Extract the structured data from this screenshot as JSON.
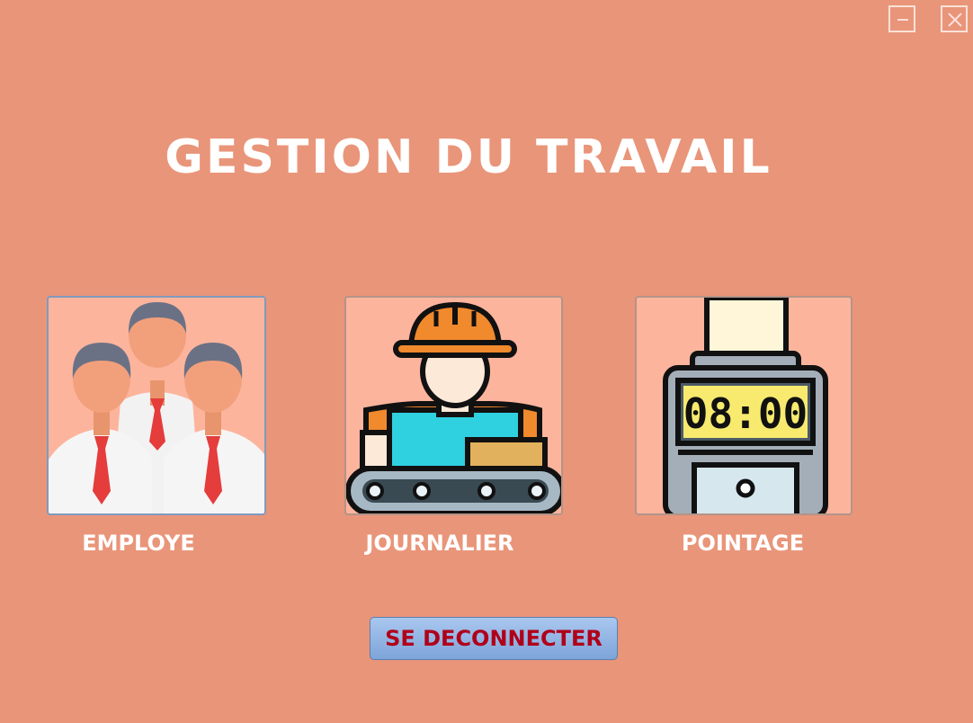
{
  "window": {
    "minimize_icon": "minimize-icon",
    "close_icon": "close-icon",
    "background_color": "#E9957A"
  },
  "header": {
    "title": "GESTION DU TRAVAIL"
  },
  "menu": {
    "items": [
      {
        "label": "EMPLOYE",
        "icon": "employees-group-icon"
      },
      {
        "label": "JOURNALIER",
        "icon": "worker-conveyor-icon"
      },
      {
        "label": "POINTAGE",
        "icon": "time-clock-icon"
      }
    ],
    "tile_background": "#FDB49D"
  },
  "clock_display": "08:00",
  "logout": {
    "label": "SE DECONNECTER",
    "text_color": "#B0001A"
  }
}
